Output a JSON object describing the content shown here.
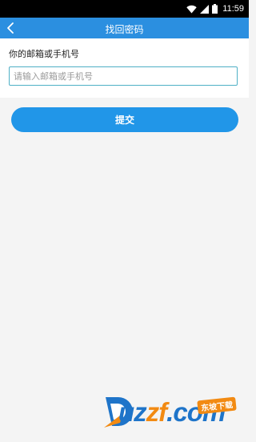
{
  "status_bar": {
    "time": "11:59"
  },
  "nav": {
    "title": "找回密码"
  },
  "form": {
    "label": "你的邮箱或手机号",
    "input_value": "",
    "input_placeholder": "请输入邮箱或手机号"
  },
  "submit": {
    "label": "提交"
  },
  "watermark": {
    "logo_text": "uzzf.com",
    "badge_text": "东坡下载"
  },
  "colors": {
    "nav_bg": "#2b8fe0",
    "button_bg": "#2196e8",
    "input_border": "#4fb0c6",
    "page_bg": "#f4f4f4"
  }
}
